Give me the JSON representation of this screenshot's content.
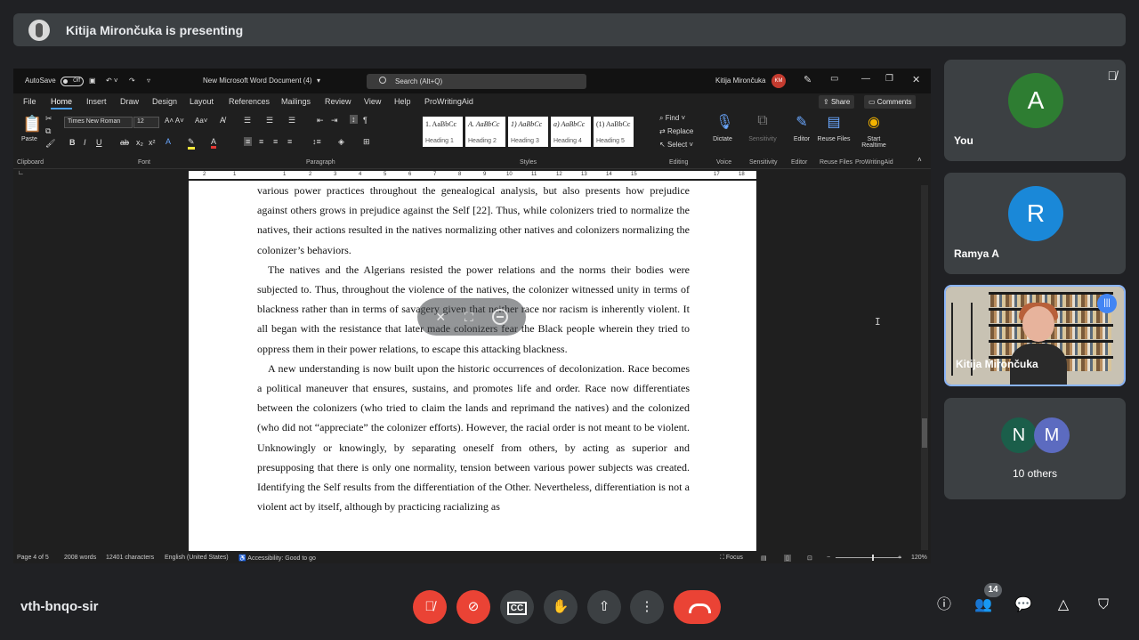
{
  "meet": {
    "presenter_banner": "Kitija Mirončuka is presenting",
    "meeting_code": "vth-bnqo-sir",
    "participants_count": "14",
    "tiles": [
      {
        "name": "You",
        "initial": "A",
        "color": "#2e7d32"
      },
      {
        "name": "Ramya A",
        "initial": "R",
        "color": "#1a88d8"
      },
      {
        "name": "Kitija Mirončuka",
        "type": "video"
      },
      {
        "name": "10 others",
        "initials": [
          "N",
          "M"
        ],
        "colors": [
          "#1b5e4a",
          "#5c6bc0"
        ]
      }
    ],
    "controls": [
      "mic-off",
      "camera-off",
      "captions",
      "raise-hand",
      "present",
      "more-options",
      "end-call"
    ],
    "right_controls": [
      "info",
      "people",
      "chat",
      "activities",
      "host-controls"
    ]
  },
  "word": {
    "autosave_label": "AutoSave",
    "autosave_state": "Off",
    "doc_title": "New Microsoft Word Document (4)",
    "search_placeholder": "Search (Alt+Q)",
    "user_name": "Kitija Mirončuka",
    "user_initials": "KM",
    "menu_tabs": [
      "File",
      "Home",
      "Insert",
      "Draw",
      "Design",
      "Layout",
      "References",
      "Mailings",
      "Review",
      "View",
      "Help",
      "ProWritingAid"
    ],
    "share_label": "Share",
    "comments_label": "Comments",
    "font_name": "Times New Roman",
    "font_size": "12",
    "paste_label": "Paste",
    "groups": [
      "Clipboard",
      "Font",
      "Paragraph",
      "Styles",
      "Editing",
      "Voice",
      "Sensitivity",
      "Editor",
      "Reuse Files",
      "ProWritingAid"
    ],
    "styles": [
      {
        "preview": "1. AaBbCc",
        "name": "Heading 1"
      },
      {
        "preview": "A. AaBbCc",
        "name": "Heading 2"
      },
      {
        "preview": "1) AaBbCc",
        "name": "Heading 3"
      },
      {
        "preview": "a) AaBbCc",
        "name": "Heading 4"
      },
      {
        "preview": "(1) AaBbCc",
        "name": "Heading 5"
      }
    ],
    "editing": {
      "find": "Find",
      "replace": "Replace",
      "select": "Select"
    },
    "big_buttons": {
      "dictate": "Dictate",
      "sensitivity": "Sensitivity",
      "editor": "Editor",
      "reuse": "Reuse Files",
      "realtime": "Start Realtime"
    },
    "ruler_numbers": [
      "2",
      "1",
      "1",
      "2",
      "3",
      "4",
      "5",
      "6",
      "7",
      "8",
      "9",
      "10",
      "11",
      "12",
      "13",
      "14",
      "15",
      "17",
      "18"
    ],
    "paragraphs": [
      "various power practices throughout the genealogical analysis, but also presents how prejudice against others grows in prejudice against the Self [22]. Thus, while colonizers tried to normalize the natives, their actions resulted in the natives normalizing other natives and colonizers normalizing the colonizer’s behaviors.",
      "The natives and the Algerians resisted the power relations and the norms their bodies were subjected to. Thus, throughout the violence of the natives, the colonizer witnessed unity in terms of blackness rather than in terms of savagery given that neither race nor racism is inherently violent. It all began with the resistance that later made colonizers fear the Black people wherein they tried to oppress them in their power relations, to escape this attacking blackness.",
      "A new understanding is now built upon the historic occurrences of decolonization. Race becomes a political maneuver that ensures, sustains, and promotes life and order. Race now differentiates between the colonizers (who tried to claim the lands and reprimand the natives) and the colonized (who did not “appreciate” the colonizer efforts). However, the racial order is not meant to be violent. Unknowingly or knowingly, by separating oneself from others, by acting as superior and presupposing that there is only one normality, tension between various power subjects was created. Identifying the Self results from the differentiation of the Other. Nevertheless, differentiation is not a violent act by itself, although by practicing racializing as"
    ],
    "status": {
      "page": "Page 4 of 5",
      "words": "2008 words",
      "chars": "12401 characters",
      "language": "English (United States)",
      "accessibility": "Accessibility: Good to go",
      "focus": "Focus",
      "zoom": "120%"
    }
  }
}
